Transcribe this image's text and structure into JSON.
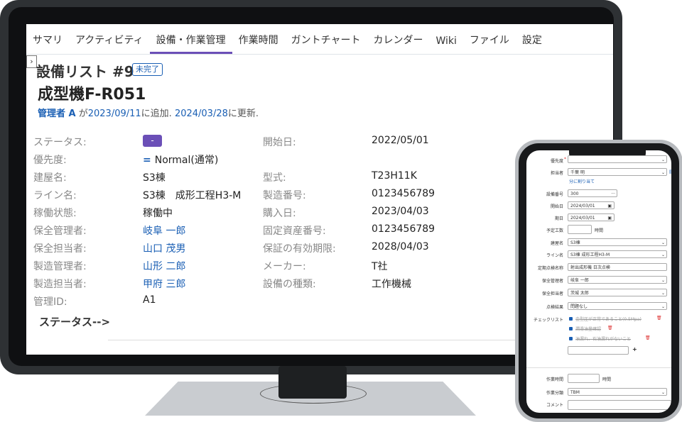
{
  "tabs": [
    "サマリ",
    "アクティビティ",
    "設備・作業管理",
    "作業時間",
    "ガントチャート",
    "カレンダー",
    "Wiki",
    "ファイル",
    "設定"
  ],
  "sidebar_toggle": "›",
  "list_title": "設備リスト #9",
  "status_badge": "未完了",
  "equip_title": "成型機F-R051",
  "meta": {
    "author": "管理者 A",
    "mid1": " が",
    "created": "2023/09/11",
    "mid2": "に追加. ",
    "updated": "2024/03/28",
    "mid3": "に更新."
  },
  "fields": {
    "status": {
      "label": "ステータス:",
      "value": "-"
    },
    "start": {
      "label": "開始日:",
      "value": "2022/05/01"
    },
    "priority": {
      "label": "優先度:",
      "icon": "=",
      "value": "Normal(通常)"
    },
    "building": {
      "label": "建屋名:",
      "value": "S3棟"
    },
    "model": {
      "label": "型式:",
      "value": "T23H11K"
    },
    "line": {
      "label": "ライン名:",
      "value": "S3棟　成形工程H3-M"
    },
    "serial": {
      "label": "製造番号:",
      "value": "0123456789"
    },
    "operation": {
      "label": "稼働状態:",
      "value": "稼働中"
    },
    "purchase": {
      "label": "購入日:",
      "value": "2023/04/03"
    },
    "maint_manager": {
      "label": "保全管理者:",
      "value": "岐阜 一郎"
    },
    "asset_no": {
      "label": "固定資産番号:",
      "value": "0123456789"
    },
    "maint_person": {
      "label": "保全担当者:",
      "value": "山口 茂男"
    },
    "warranty": {
      "label": "保証の有効期限:",
      "value": "2028/04/03"
    },
    "mfg_manager": {
      "label": "製造管理者:",
      "value": "山形 二郎"
    },
    "maker": {
      "label": "メーカー:",
      "value": "T社"
    },
    "mfg_person": {
      "label": "製造担当者:",
      "value": "甲府 三郎"
    },
    "equip_type": {
      "label": "設備の種類:",
      "value": "工作機械"
    },
    "admin_id": {
      "label": "管理ID:",
      "value": "A1"
    }
  },
  "status_link": "ステータス-->",
  "phone": {
    "priority_label": "優先度",
    "assignee_label": "担当者",
    "assignee_value": "千葉 明",
    "assign_me": "分に割り当て",
    "equip_no_label": "設備番号",
    "equip_no_value": "300",
    "start_label": "開始日",
    "start_value": "2024/03/01",
    "due_label": "期日",
    "due_value": "2024/03/01",
    "est_label": "予定工数",
    "hours": "時間",
    "building_label": "建屋名",
    "building_value": "S3棟",
    "line_label": "ライン名",
    "line_value": "S3棟 成形工程H3-M",
    "inspection_label": "定期点検名称",
    "inspection_value": "射出成形機 日次点検",
    "maint_manager_label": "保全管理者",
    "maint_manager_value": "岐阜 一郎",
    "maint_person_label": "保全担当者",
    "maint_person_value": "茨城 太郎",
    "result_label": "点検結果",
    "result_value": "問題なし",
    "checklist_label": "チェックリスト",
    "check1": "金型圧が正常であること(0.5Mpa)",
    "check2": "潤滑油量確認",
    "check3": "油漏れ、石油漏れがないこと",
    "work_time_label": "作業時間",
    "work_time_unit": "時間",
    "work_type_label": "作業分類",
    "work_type_value": "TBM",
    "comment_label": "コメント"
  }
}
